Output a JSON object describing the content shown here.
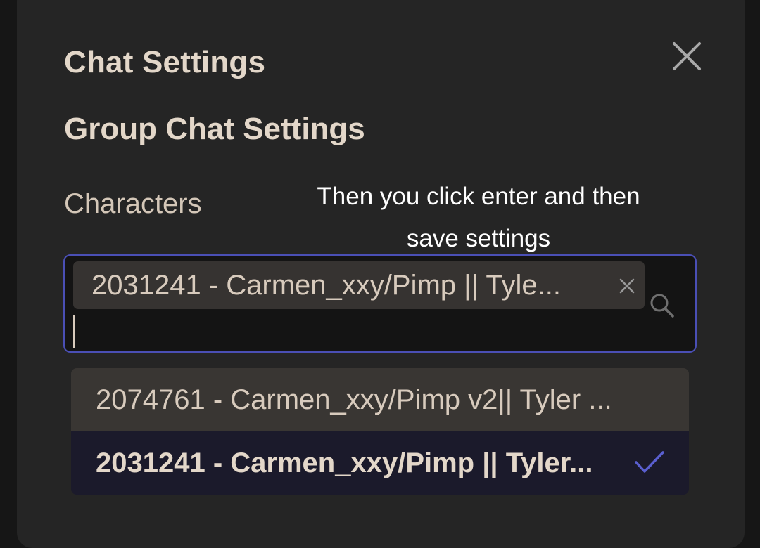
{
  "modal": {
    "title": "Chat Settings",
    "section_title": "Group Chat Settings",
    "close_icon": "close-icon"
  },
  "characters": {
    "label": "Characters",
    "selected_chip": "2031241 - Carmen_xxy/Pimp || Tyle...",
    "chip_remove_icon": "close-icon",
    "search_icon": "search-icon",
    "input_value": ""
  },
  "annotation": {
    "text": "Then you click enter and then save settings"
  },
  "dropdown": {
    "options": [
      {
        "label": "2074761 - Carmen_xxy/Pimp v2|| Tyler ...",
        "selected": false
      },
      {
        "label": "2031241 - Carmen_xxy/Pimp || Tyler...",
        "selected": true
      }
    ],
    "check_icon": "check-icon"
  },
  "colors": {
    "accent": "#4a4fb5",
    "modal_bg": "#252525",
    "text": "#e3d7c9"
  }
}
